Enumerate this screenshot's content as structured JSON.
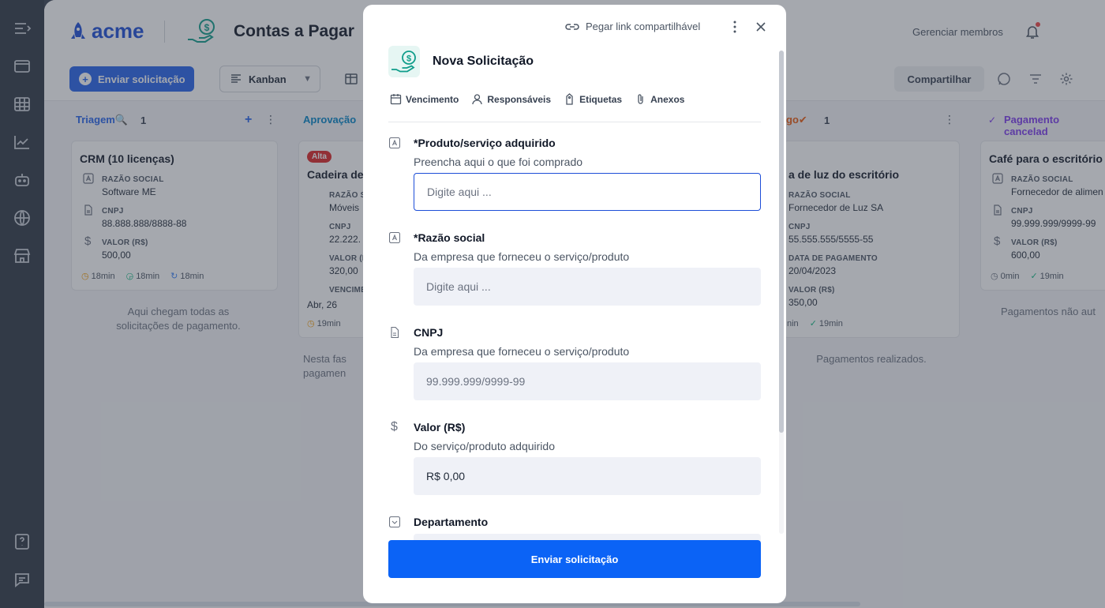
{
  "app": {
    "logo_text": "acme",
    "pipe_title": "Contas a Pagar",
    "manage_members": "Gerenciar membros",
    "send_request_label": "Enviar solicitação",
    "view_label": "Kanban",
    "share_label": "Compartilhar"
  },
  "columns": [
    {
      "title": "Triagem🔍",
      "count": "1",
      "title_color": "#2563eb",
      "note": "Aqui chegam todas as solicitações de pagamento.",
      "card": {
        "title": "CRM (10 licenças)",
        "fields": [
          {
            "label": "RAZÃO SOCIAL",
            "value": "Software ME"
          },
          {
            "label": "CNPJ",
            "value": "88.888.888/8888-88"
          },
          {
            "label": "VALOR (R$)",
            "value": "500,00"
          }
        ],
        "meta": [
          "18min",
          "18min",
          "18min"
        ]
      }
    },
    {
      "title": "Aprovação",
      "count": "",
      "title_color": "#0284c7",
      "note": "Nesta fas pagamen",
      "card": {
        "tag": "Alta",
        "title": "Cadeira de",
        "fields": [
          {
            "label": "RAZÃO S",
            "value": "Móveis"
          },
          {
            "label": "CNPJ",
            "value": "22.222."
          },
          {
            "label": "VALOR (F",
            "value": "320,00"
          },
          {
            "label": "VENCIME",
            "value": "Abr, 26"
          }
        ],
        "meta": [
          "19min"
        ]
      }
    },
    {
      "title": "go✔",
      "count": "1",
      "title_color": "#ea580c",
      "note": "Pagamentos realizados.",
      "card": {
        "title": "a de luz do escritório",
        "fields": [
          {
            "label": "RAZÃO SOCIAL",
            "value": "Fornecedor de Luz SA"
          },
          {
            "label": "CNPJ",
            "value": "55.555.555/5555-55"
          },
          {
            "label": "DATA DE PAGAMENTO",
            "value": "20/04/2023"
          },
          {
            "label": "VALOR (R$)",
            "value": "350,00"
          }
        ],
        "meta": [
          "nin",
          "19min"
        ]
      }
    },
    {
      "title": "Pagamento cancelad",
      "count": "",
      "title_color": "#7c3aed",
      "note": "Pagamentos não aut",
      "card": {
        "title": "Café para o escritório",
        "fields": [
          {
            "label": "RAZÃO SOCIAL",
            "value": "Fornecedor de alimen"
          },
          {
            "label": "CNPJ",
            "value": "99.999.999/9999-99"
          },
          {
            "label": "VALOR (R$)",
            "value": "600,00"
          }
        ],
        "meta": [
          "0min",
          "19min"
        ]
      }
    }
  ],
  "modal": {
    "share_link": "Pegar link compartilhável",
    "title": "Nova Solicitação",
    "meta": [
      "Vencimento",
      "Responsáveis",
      "Etiquetas",
      "Anexos"
    ],
    "fields": [
      {
        "label": "*Produto/serviço adquirido",
        "help": "Preencha aqui o que foi comprado",
        "placeholder": "Digite aqui ...",
        "value": ""
      },
      {
        "label": "*Razão social",
        "help": "Da empresa que forneceu o serviço/produto",
        "placeholder": "Digite aqui ...",
        "value": ""
      },
      {
        "label": "CNPJ",
        "help": "Da empresa que forneceu o serviço/produto",
        "placeholder": "99.999.999/9999-99",
        "value": ""
      },
      {
        "label": "Valor (R$)",
        "help": "Do serviço/produto adquirido",
        "placeholder": "",
        "value": "R$ 0,00"
      },
      {
        "label": "Departamento",
        "help": "",
        "placeholder": "",
        "value": ""
      }
    ],
    "submit_label": "Enviar solicitação"
  },
  "colors": {
    "primary": "#0b63f6",
    "rail": "#2f3744",
    "field_bg": "#eff1f7",
    "focus_border": "#1d4ed8"
  }
}
